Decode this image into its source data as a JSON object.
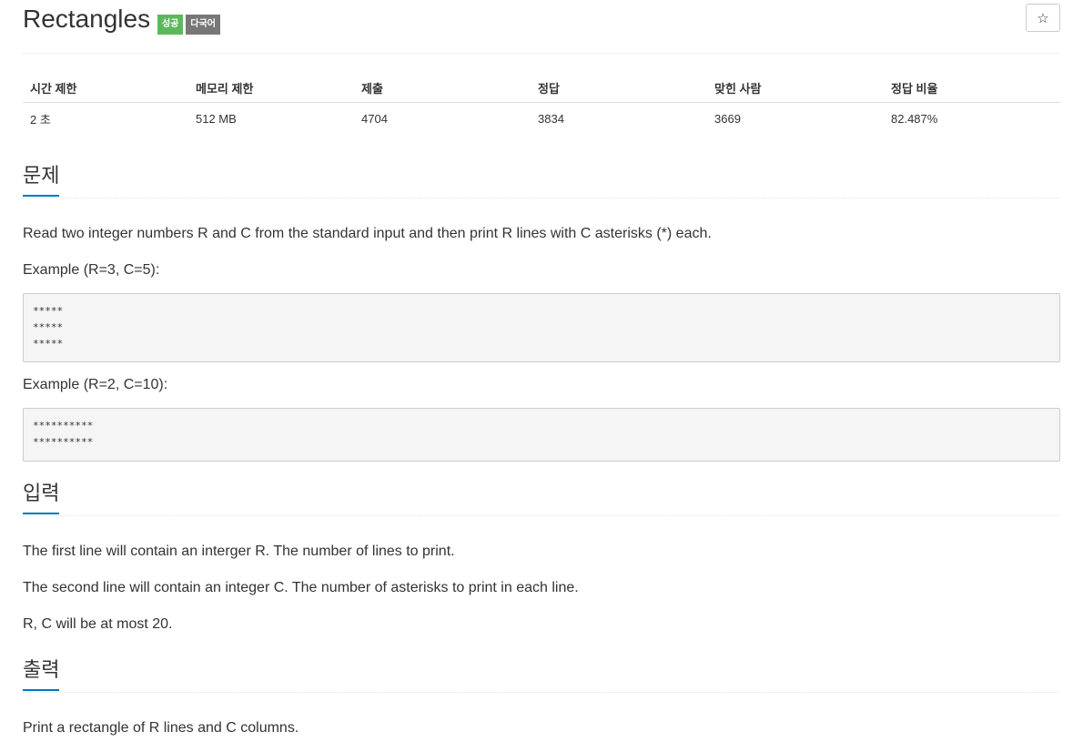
{
  "problem": {
    "title": "Rectangles",
    "badges": {
      "success": "성공",
      "multilang": "다국어"
    },
    "star_icon": "☆"
  },
  "info_table": {
    "headers": [
      "시간 제한",
      "메모리 제한",
      "제출",
      "정답",
      "맞힌 사람",
      "정답 비율"
    ],
    "values": [
      "2 초",
      "512 MB",
      "4704",
      "3834",
      "3669",
      "82.487%"
    ]
  },
  "sections": {
    "problem_heading": "문제",
    "problem_text": "Read two integer numbers R and C from the standard input and then print R lines with C asterisks (*) each.",
    "example1_label": "Example (R=3, C=5):",
    "example1_code": "*****\n*****\n*****",
    "example2_label": "Example (R=2, C=10):",
    "example2_code": "**********\n**********",
    "input_heading": "입력",
    "input_lines": [
      "The first line will contain an interger R. The number of lines to print.",
      "The second line will contain an integer C. The number of asterisks to print in each line.",
      "R, C will be at most 20."
    ],
    "output_heading": "출력",
    "output_text": "Print a rectangle of R lines and C columns."
  },
  "colors": {
    "success_badge": "#5cb85c",
    "multilang_badge": "#777777",
    "section_underline": "#0076c0"
  }
}
